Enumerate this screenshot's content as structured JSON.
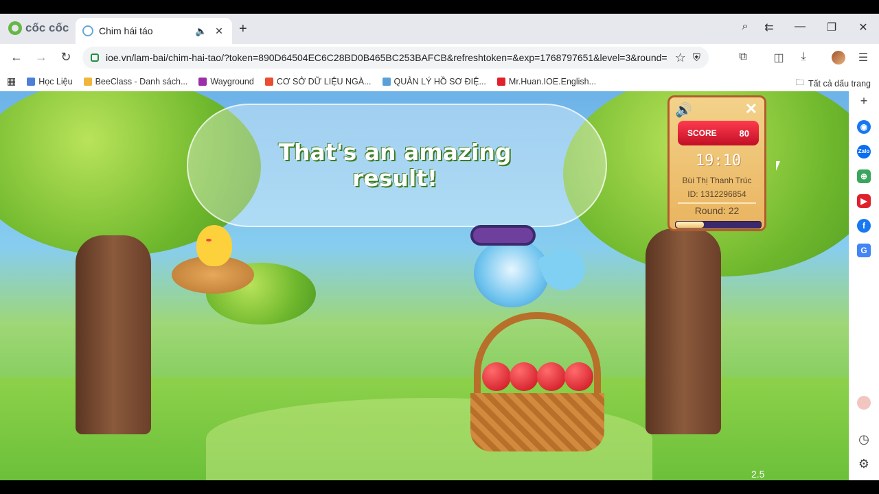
{
  "browser": {
    "brand": "cốc cốc",
    "tab_title": "Chim hái táo",
    "url": "ioe.vn/lam-bai/chim-hai-tao/?token=890D64504EC6C28BD0B465BC253BAFCB&refreshtoken=&exp=1768797651&level=3&round=...",
    "bookmarks": [
      "Học Liệu",
      "BeeClass - Danh sách...",
      "Wayground",
      "CƠ SỞ DỮ LIỆU NGÀ...",
      "QUẢN LÝ HỒ SƠ ĐIỆ...",
      "Mr.Huan.IOE.English..."
    ],
    "bookmarks_all": "Tất cả dấu trang",
    "bookmark_colors": [
      "#4d7fd6",
      "#f0b63c",
      "#9b2fa8",
      "#e84e32",
      "#5aa0d8",
      "#e0202a"
    ]
  },
  "game": {
    "message": "That's an amazing result!",
    "score_label": "SCORE",
    "score_value": "80",
    "timer": "19:10",
    "player_name": "Bùi Thị Thanh Trúc",
    "player_id": "ID: 1312296854",
    "round": "Round: 22",
    "progress_fraction": 0.33,
    "version": "2.5"
  }
}
